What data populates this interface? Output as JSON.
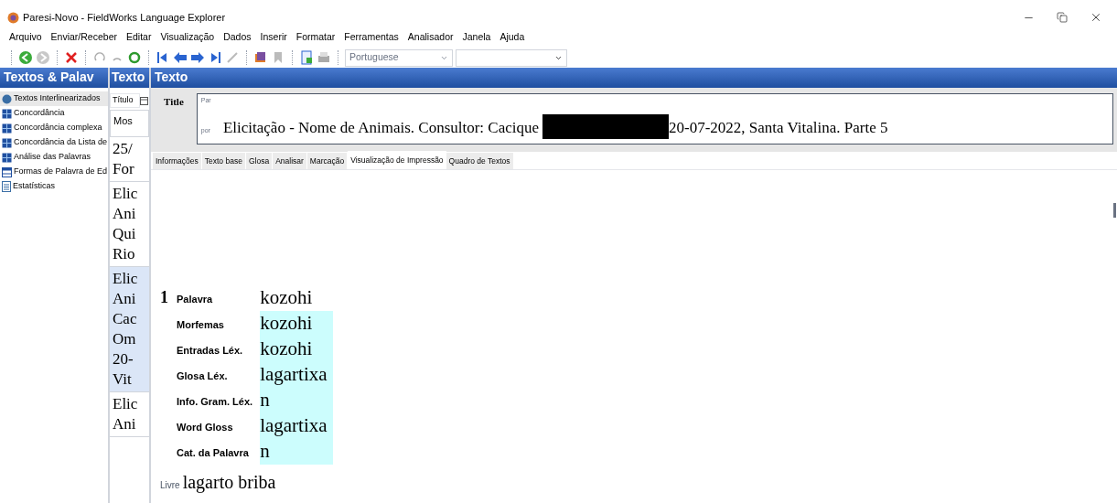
{
  "window": {
    "title": "Paresi-Novo - FieldWorks Language Explorer"
  },
  "menu": [
    "Arquivo",
    "Enviar/Receber",
    "Editar",
    "Visualização",
    "Dados",
    "Inserir",
    "Formatar",
    "Ferramentas",
    "Analisador",
    "Janela",
    "Ajuda"
  ],
  "toolbar": {
    "writing_system": {
      "value": "Portuguese"
    }
  },
  "headers": [
    "Textos & Palav",
    "Texto",
    "Texto"
  ],
  "sidebar": {
    "items": [
      {
        "label": "Textos Interlinearizados",
        "selected": true
      },
      {
        "label": "Concordância",
        "selected": false
      },
      {
        "label": "Concordância complexa",
        "selected": false
      },
      {
        "label": "Concordância da Lista de",
        "selected": false
      },
      {
        "label": "Análise das Palavras",
        "selected": false
      },
      {
        "label": "Formas de Palavra de Ed",
        "selected": false
      },
      {
        "label": "Estatísticas",
        "selected": false
      }
    ]
  },
  "text_list": {
    "column": "Título",
    "filter": "Mos",
    "groups": [
      {
        "lines": [
          "25/",
          "For"
        ],
        "selected": false
      },
      {
        "lines": [
          "Elic",
          "Ani",
          "Qui",
          "Rio"
        ],
        "selected": false
      },
      {
        "lines": [
          "Elic",
          "Ani",
          "Cac",
          "Om",
          "20-",
          "Vit"
        ],
        "selected": true
      },
      {
        "lines": [
          "Elic",
          "Ani"
        ],
        "selected": false
      }
    ]
  },
  "title_field": {
    "label": "Title",
    "ws_top": "Par",
    "ws_bottom": "por",
    "value_before": "Elicitação - Nome de Animais. Consultor: Cacique",
    "value_after": "20-07-2022, Santa Vitalina. Parte 5"
  },
  "tabs": [
    {
      "label": "Informações",
      "selected": false
    },
    {
      "label": "Texto base",
      "selected": false
    },
    {
      "label": "Glosa",
      "selected": false
    },
    {
      "label": "Analisar",
      "selected": false
    },
    {
      "label": "Marcação",
      "selected": false
    },
    {
      "label": "Visualização de Impressão",
      "selected": true
    },
    {
      "label": "Quadro de Textos",
      "selected": false
    }
  ],
  "interlinear": {
    "number": "1",
    "rows": [
      {
        "label": "Palavra",
        "value": "kozohi",
        "highlighted": false
      },
      {
        "label": "Morfemas",
        "value": "kozohi",
        "highlighted": true
      },
      {
        "label": "Entradas Léx.",
        "value": "kozohi",
        "highlighted": true
      },
      {
        "label": "Glosa Léx.",
        "value": "lagartixa",
        "highlighted": true
      },
      {
        "label": "Info. Gram. Léx.",
        "value": "n",
        "highlighted": true
      },
      {
        "label": "Word Gloss",
        "value": "lagartixa",
        "highlighted": true
      },
      {
        "label": "Cat. da Palavra",
        "value": "n",
        "highlighted": true
      }
    ],
    "free": {
      "label": "Livre",
      "value": "lagarto briba"
    }
  }
}
